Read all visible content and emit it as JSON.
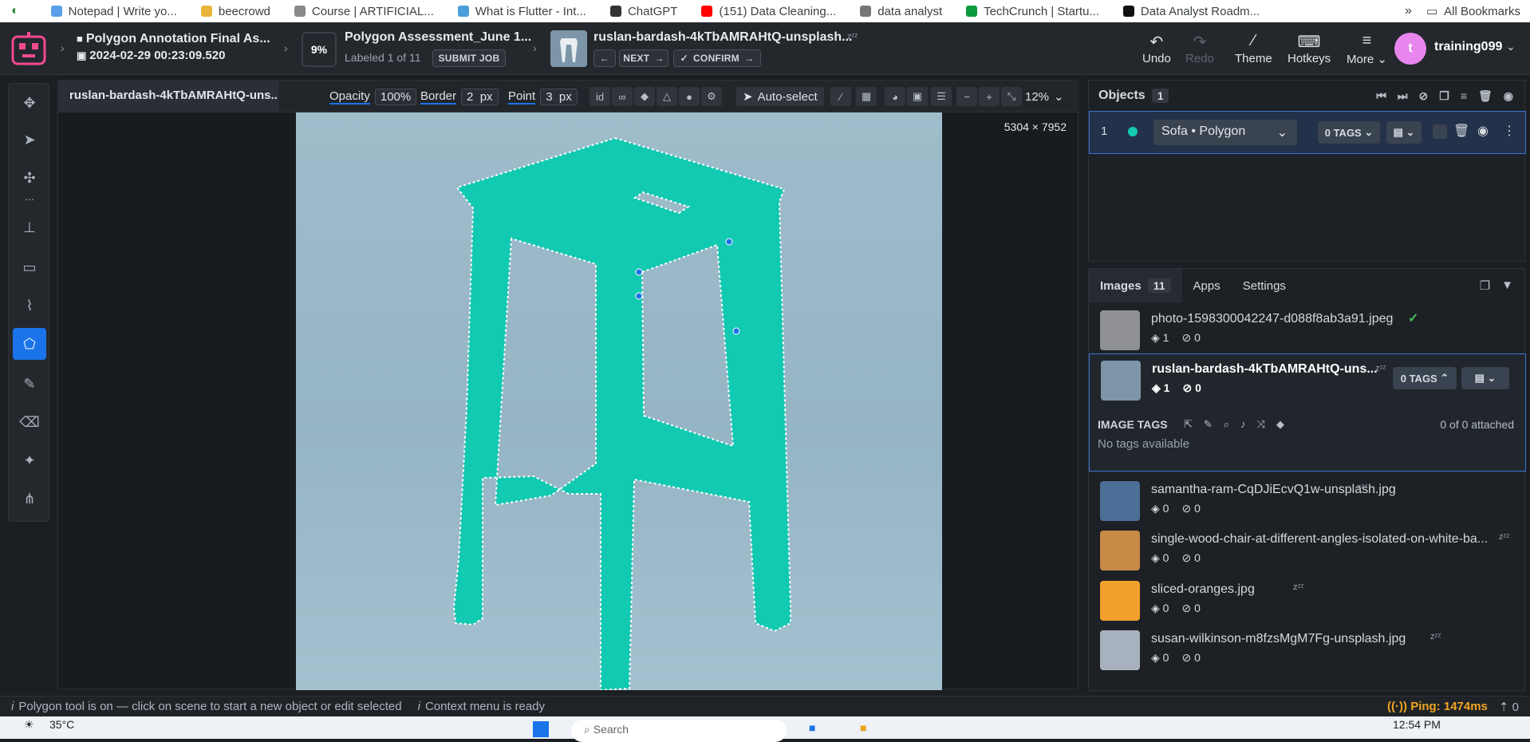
{
  "bookmarks": [
    {
      "label": "Notepad | Write yo...",
      "color": "#5aa0e8"
    },
    {
      "label": "beecrowd",
      "color": "#e8b63a"
    },
    {
      "label": "Course | ARTIFICIAL...",
      "color": "#888888"
    },
    {
      "label": "What is Flutter - Int...",
      "color": "#4b9fd8"
    },
    {
      "label": "ChatGPT",
      "color": "#333333"
    },
    {
      "label": "(151) Data Cleaning...",
      "color": "#ff0000"
    },
    {
      "label": "data analyst",
      "color": "#777777"
    },
    {
      "label": "TechCrunch | Startu...",
      "color": "#0a9a3b"
    },
    {
      "label": "Data Analyst Roadm...",
      "color": "#111111"
    }
  ],
  "all_bookmarks": "All Bookmarks",
  "header": {
    "project_title": "Polygon Annotation Final As...",
    "project_date": "2024-02-29 00:23:09.520",
    "progress": "9%",
    "job_title": "Polygon Assessment_June 1...",
    "labeled": "Labeled 1 of 11",
    "submit": "SUBMIT JOB",
    "image_title": "ruslan-bardash-4kTbAMRAHtQ-unsplash...",
    "next": "NEXT",
    "confirm": "CONFIRM",
    "undo": "Undo",
    "redo": "Redo",
    "theme": "Theme",
    "hotkeys": "Hotkeys",
    "more": "More",
    "user_initial": "t",
    "username": "training099"
  },
  "canvas": {
    "file_tab": "ruslan-bardash-4kTbAMRAHtQ-uns...",
    "opacity_label": "Opacity",
    "opacity_value": "100%",
    "border_label": "Border",
    "border_value": "2",
    "border_unit": "px",
    "point_label": "Point",
    "point_value": "3",
    "point_unit": "px",
    "auto_select": "Auto-select",
    "zoom": "12%",
    "dimensions": "5304 × 7952",
    "fill_color": "#12c9b1"
  },
  "objects": {
    "title": "Objects",
    "count": "1",
    "row_index": "1",
    "class_label": "Sofa • Polygon",
    "tags": "0 TAGS"
  },
  "images": {
    "tab_images": "Images",
    "count": "11",
    "tab_apps": "Apps",
    "tab_settings": "Settings",
    "items": [
      {
        "name": "photo-1598300042247-d088f8ab3a91.jpeg",
        "objects": "1",
        "tags": "0",
        "thumb": "#8e9096"
      },
      {
        "name": "samantha-ram-CqDJiEcvQ1w-unsplash.jpg",
        "objects": "0",
        "tags": "0",
        "thumb": "#4b6f96"
      },
      {
        "name": "single-wood-chair-at-different-angles-isolated-on-white-ba...",
        "objects": "0",
        "tags": "0",
        "thumb": "#c98a46"
      },
      {
        "name": "sliced-oranges.jpg",
        "objects": "0",
        "tags": "0",
        "thumb": "#f1a02b"
      },
      {
        "name": "susan-wilkinson-m8fzsMgM7Fg-unsplash.jpg",
        "objects": "0",
        "tags": "0",
        "thumb": "#a8b2be"
      }
    ],
    "current": {
      "name": "ruslan-bardash-4kTbAMRAHtQ-uns...",
      "objects": "1",
      "tags": "0",
      "tags_btn": "0 TAGS",
      "image_tags_label": "IMAGE TAGS",
      "attached": "0 of 0 attached",
      "no_tags": "No tags available"
    }
  },
  "status": {
    "tool_msg": "Polygon tool is on — click on scene to start a new object or edit selected",
    "context_msg": "Context menu is ready",
    "ping": "Ping: 1474ms",
    "uploads": "0"
  },
  "taskbar": {
    "temp": "35°C",
    "search": "Search",
    "time": "12:54 PM"
  }
}
